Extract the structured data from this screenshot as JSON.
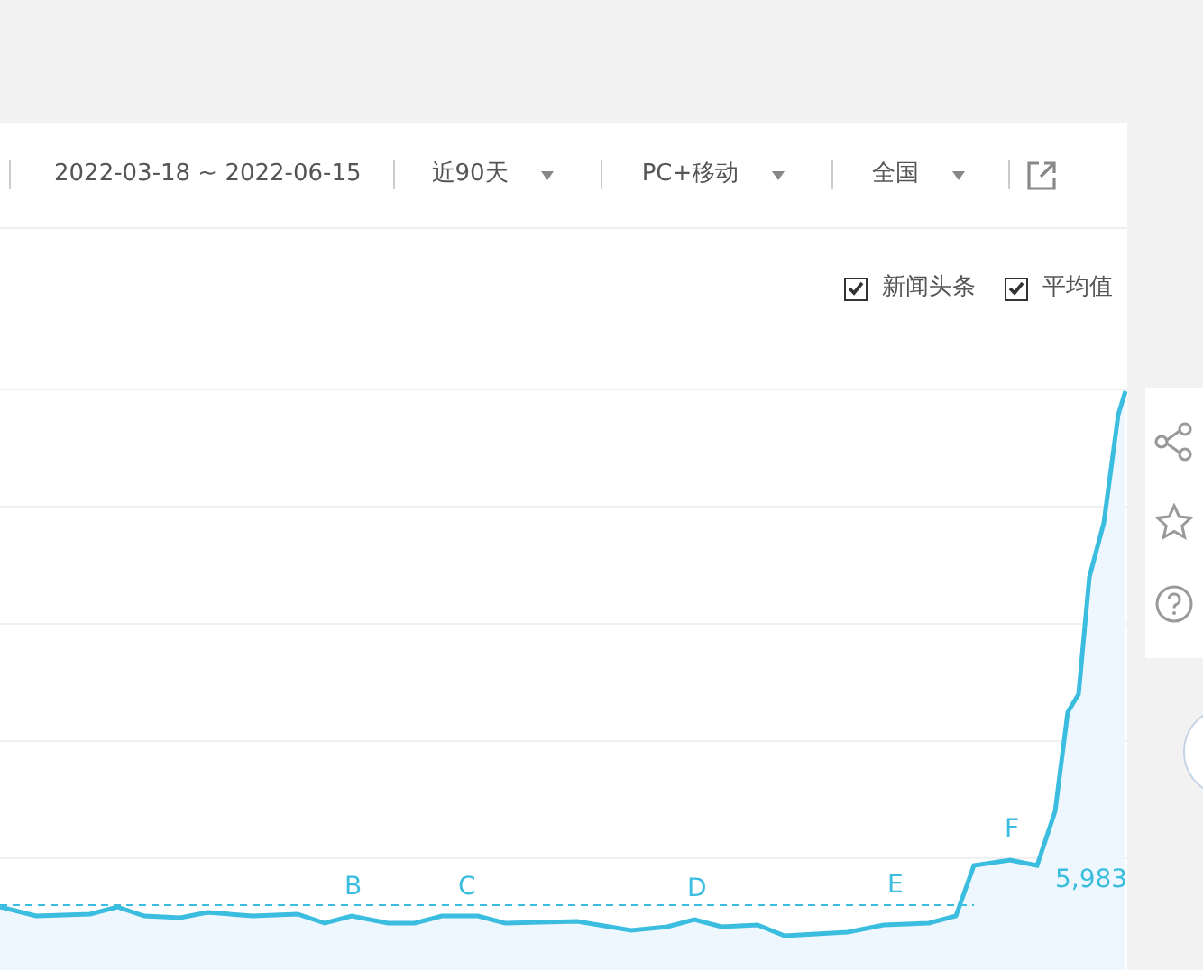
{
  "toolbar": {
    "date_range": "2022-03-18 ~ 2022-06-15",
    "dropdowns": [
      {
        "label": "近90天"
      },
      {
        "label": "PC+移动"
      },
      {
        "label": "全国"
      }
    ]
  },
  "legend": [
    {
      "label": "新闻头条",
      "checked": true
    },
    {
      "label": "平均值",
      "checked": true
    }
  ],
  "chart": {
    "kind": "picture",
    "annotations": [
      "B",
      "C",
      "D",
      "E",
      "F"
    ],
    "average_label": "5,983"
  }
}
